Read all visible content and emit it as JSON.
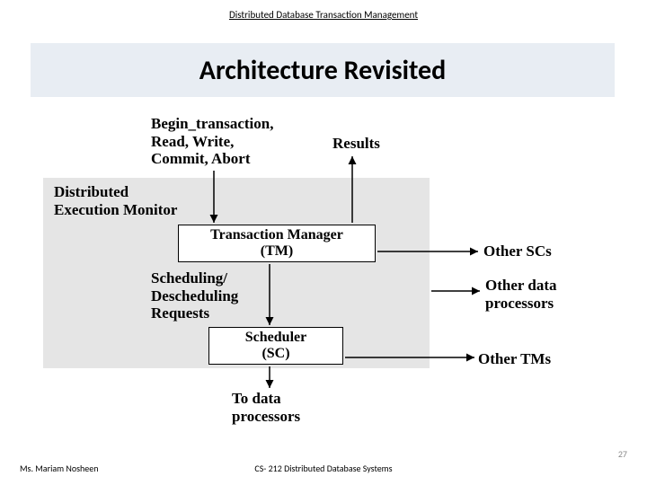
{
  "header": "Distributed Database Transaction Management",
  "title": "Architecture Revisited",
  "labels": {
    "begin": "Begin_transaction,\nRead, Write,\nCommit, Abort",
    "results": "Results",
    "monitor": "Distributed\nExecution Monitor",
    "tm": "Transaction Manager\n(TM)",
    "sched": "Scheduling/\nDescheduling\nRequests",
    "sc": "Scheduler\n(SC)",
    "to_dp": "To data\nprocessors",
    "other_scs": "Other SCs",
    "other_dp": "Other data\nprocessors",
    "other_tms": "Other TMs"
  },
  "footer": {
    "left": "Ms. Mariam Nosheen",
    "center": "CS- 212 Distributed Database Systems",
    "page": "27"
  }
}
